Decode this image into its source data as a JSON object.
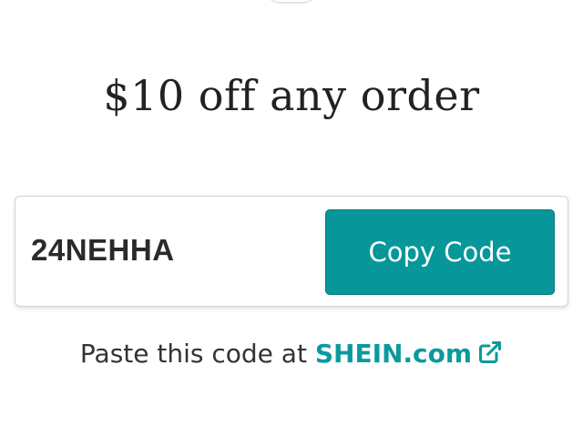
{
  "offer": {
    "title": "$10 off any order"
  },
  "coupon": {
    "code": "24NEHHA",
    "copy_label": "Copy Code"
  },
  "instructions": {
    "prefix": "Paste this code at ",
    "store_link": "SHEIN.com",
    "link_icon": "external-link-icon"
  },
  "colors": {
    "accent": "#07979a",
    "link": "#0a9a9e",
    "text": "#222222"
  }
}
